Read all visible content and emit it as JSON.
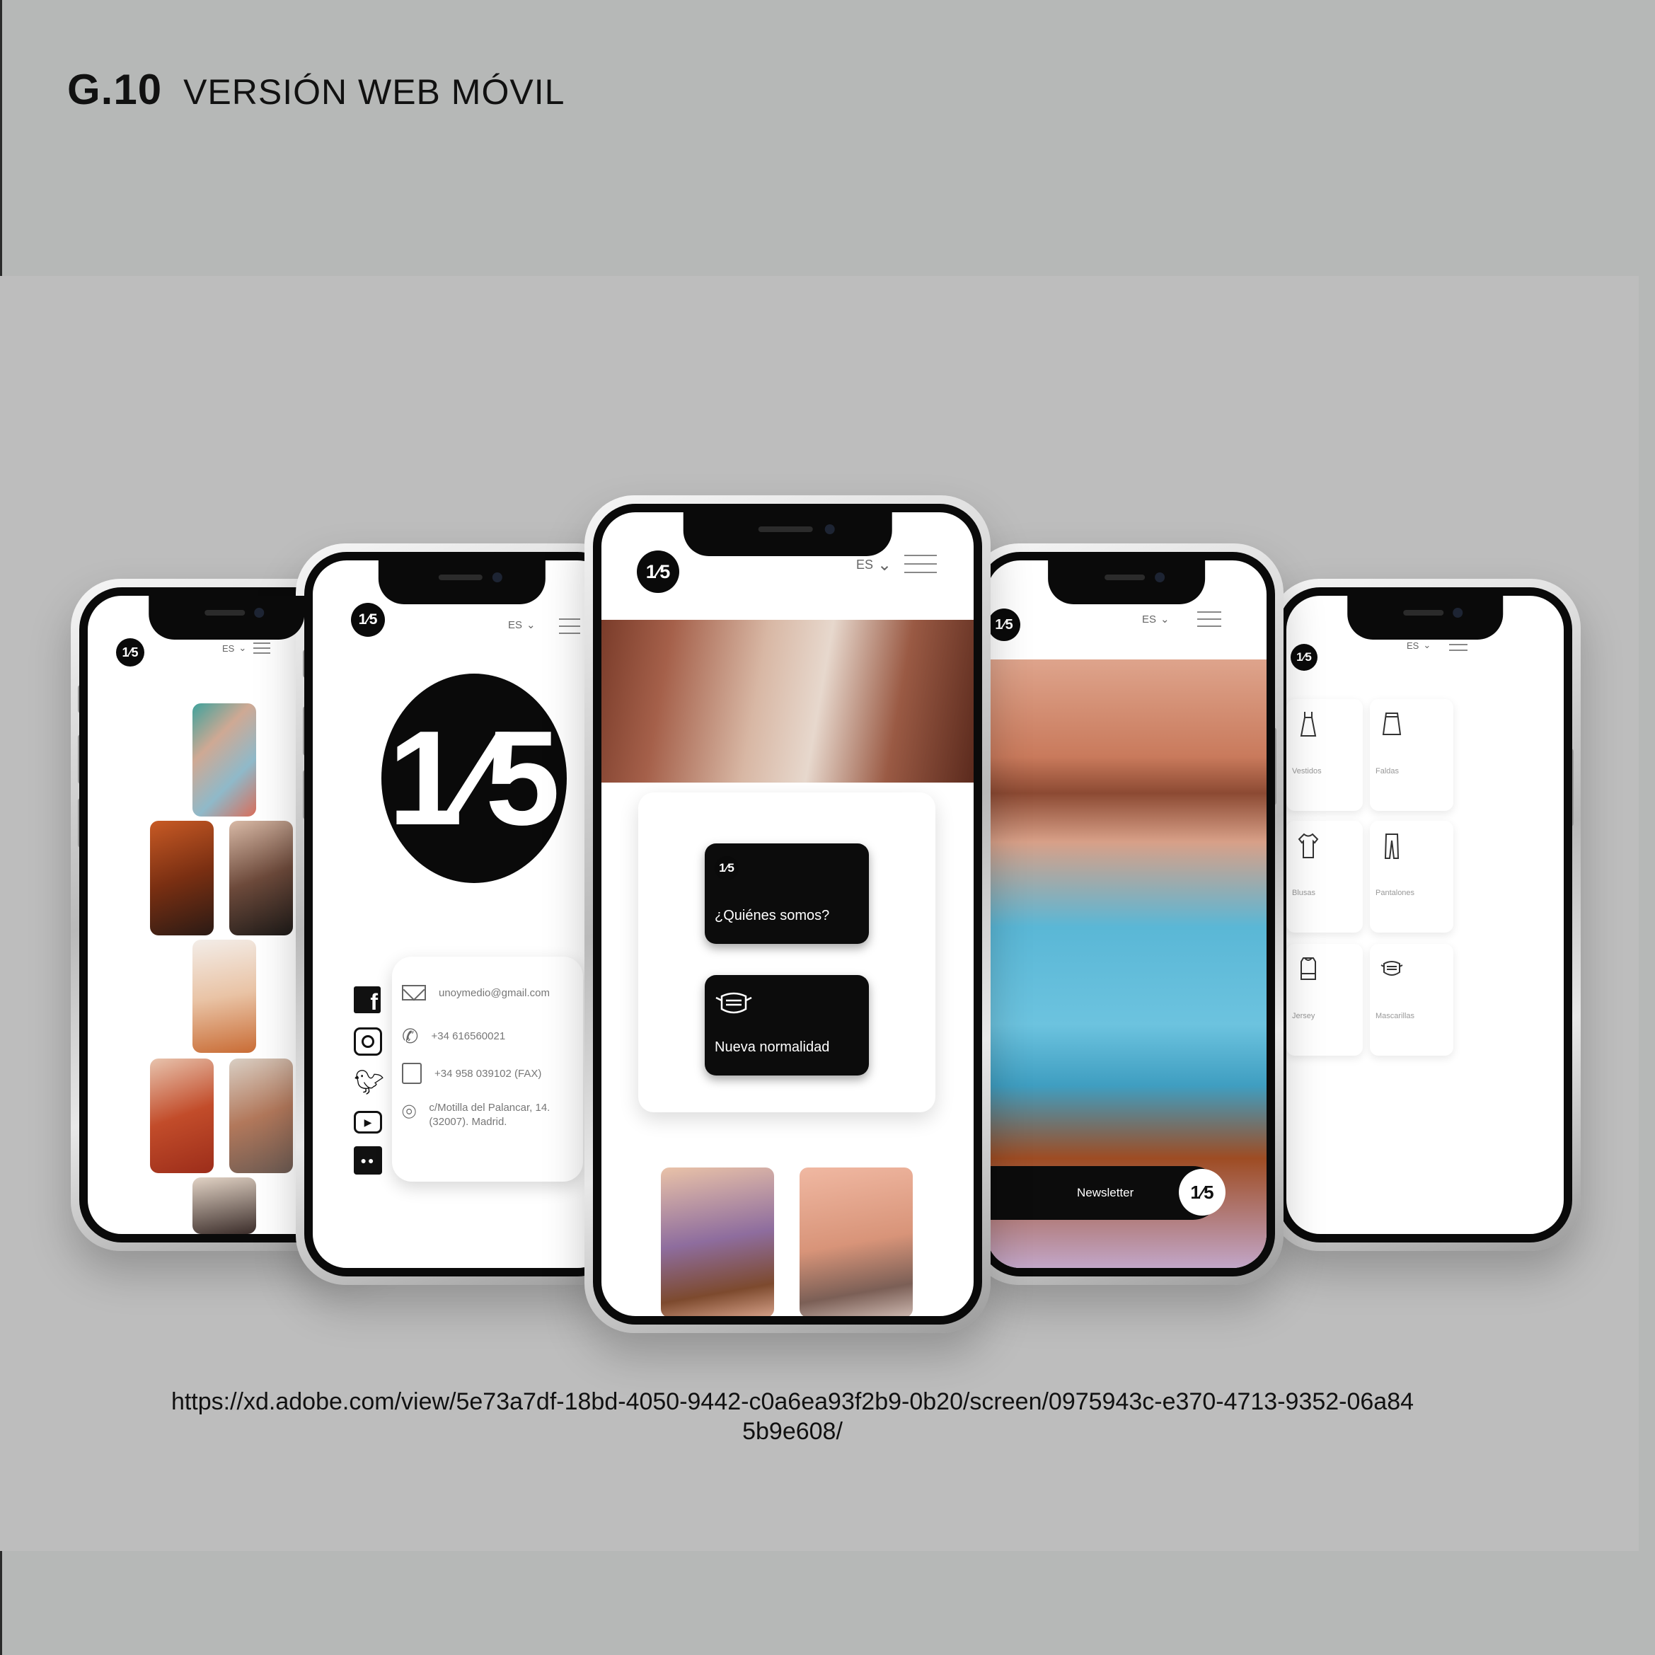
{
  "header": {
    "code": "G.10",
    "title": "VERSIÓN WEB MÓVIL"
  },
  "footer": {
    "url": "https://xd.adobe.com/view/5e73a7df-18bd-4050-9442-c0a6ea93f2b9-0b20/screen/0975943c-e370-4713-9352-06a845b9e608/"
  },
  "brand": {
    "logo_text": "1⁄5"
  },
  "nav": {
    "language": "ES"
  },
  "contact": {
    "email": "unoymedio@gmail.com",
    "phone": "+34 616560021",
    "fax": "+34 958 039102 (FAX)",
    "address": "c/Motilla del Palancar, 14. (32007). Madrid."
  },
  "home": {
    "card_about": "¿Quiénes somos?",
    "card_normal": "Nueva normalidad"
  },
  "promo": {
    "newsletter": "Newsletter"
  },
  "categories": [
    "Vestidos",
    "Faldas",
    "Blusas",
    "Pantalones",
    "Jersey",
    "Mascarillas"
  ],
  "colors": {
    "background": "#b6b8b7",
    "band": "#bdbdbd",
    "screen": "#ffffff",
    "card": "#0c0c0c"
  }
}
